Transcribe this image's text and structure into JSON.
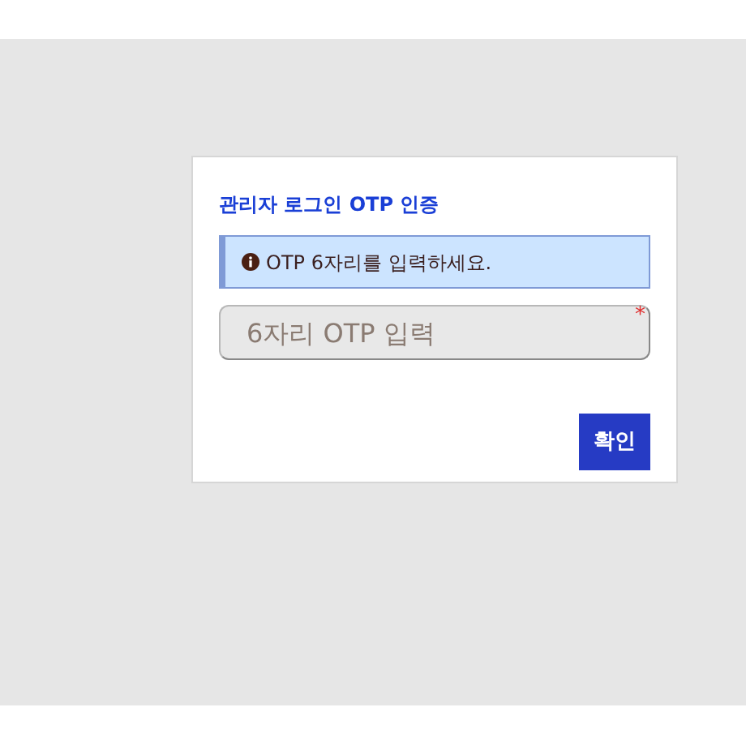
{
  "dialog": {
    "title": "관리자 로그인 OTP 인증",
    "alert": {
      "text": "OTP 6자리를 입력하세요."
    },
    "otp_field": {
      "placeholder": "6자리 OTP 입력",
      "required": true,
      "required_mark": "*"
    },
    "buttons": [
      {
        "label": "확인"
      }
    ]
  }
}
